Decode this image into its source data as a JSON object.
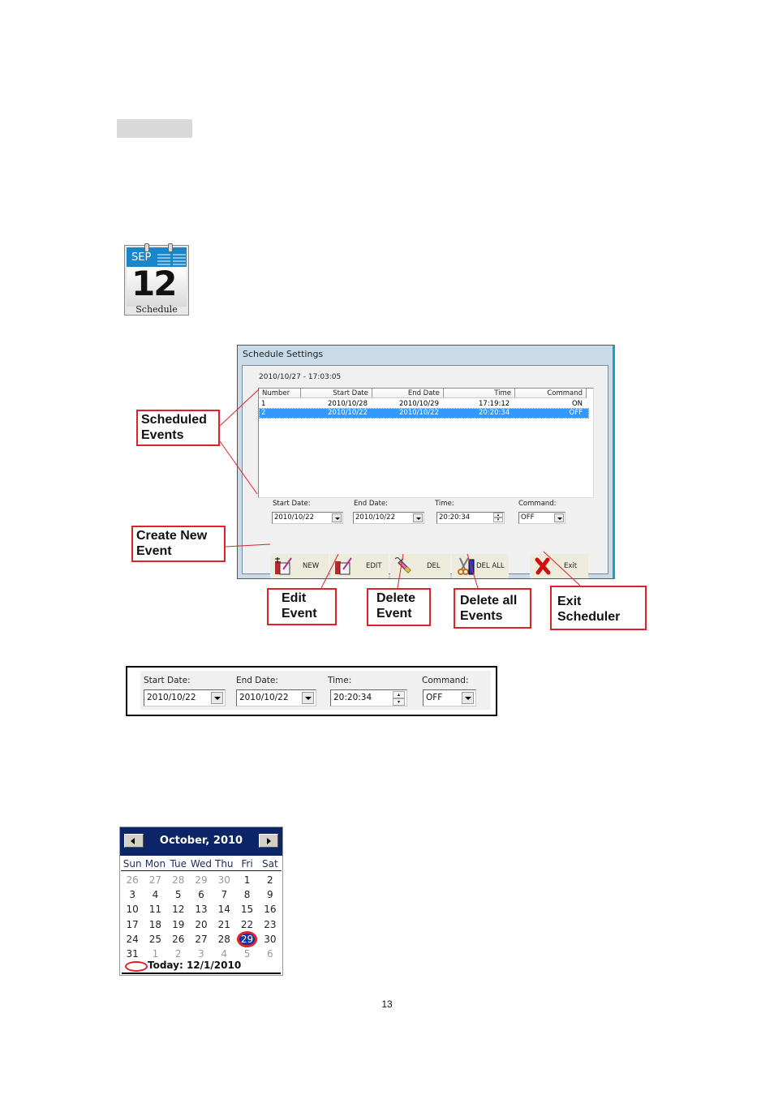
{
  "page": {
    "number": "13"
  },
  "schedule_icon": {
    "month": "SEP",
    "day": "12",
    "label": "Schedule"
  },
  "window": {
    "title": "Schedule Settings",
    "current_datetime": "2010/10/27 - 17:03:05",
    "columns": [
      "Number",
      "Start Date",
      "End Date",
      "Time",
      "Command"
    ],
    "rows": [
      {
        "number": "1",
        "start_date": "2010/10/28",
        "end_date": "2010/10/29",
        "time": "17:19:12",
        "command": "ON",
        "selected": false
      },
      {
        "number": "2",
        "start_date": "2010/10/22",
        "end_date": "2010/10/22",
        "time": "20:20:34",
        "command": "OFF",
        "selected": true
      }
    ],
    "fields": {
      "start_date_label": "Start Date:",
      "start_date_value": "2010/10/22",
      "end_date_label": "End Date:",
      "end_date_value": "2010/10/22",
      "time_label": "Time:",
      "time_value": "20:20:34",
      "command_label": "Command:",
      "command_value": "OFF"
    },
    "buttons": {
      "new": "NEW",
      "edit": "EDIT",
      "del": "DEL",
      "del_all": "DEL ALL",
      "exit": "Exit"
    }
  },
  "callouts": {
    "scheduled_events": [
      "Scheduled",
      "Events"
    ],
    "create_new_event": [
      "Create New",
      "Event"
    ],
    "edit_event": [
      "Edit",
      "Event"
    ],
    "delete_event": [
      "Delete",
      "Event"
    ],
    "delete_all_events": [
      "Delete all",
      "Events"
    ],
    "exit_scheduler": [
      "Exit",
      "Scheduler"
    ]
  },
  "colors": {
    "callout_border": "#e0202a",
    "selection": "#3399ff",
    "calendar_header": "#0b2567"
  },
  "month_calendar": {
    "title": "October, 2010",
    "weekdays": [
      "Sun",
      "Mon",
      "Tue",
      "Wed",
      "Thu",
      "Fri",
      "Sat"
    ],
    "weeks": [
      [
        {
          "d": "26",
          "o": true
        },
        {
          "d": "27",
          "o": true
        },
        {
          "d": "28",
          "o": true
        },
        {
          "d": "29",
          "o": true
        },
        {
          "d": "30",
          "o": true
        },
        {
          "d": "1"
        },
        {
          "d": "2"
        }
      ],
      [
        {
          "d": "3"
        },
        {
          "d": "4"
        },
        {
          "d": "5"
        },
        {
          "d": "6"
        },
        {
          "d": "7"
        },
        {
          "d": "8"
        },
        {
          "d": "9"
        }
      ],
      [
        {
          "d": "10"
        },
        {
          "d": "11"
        },
        {
          "d": "12"
        },
        {
          "d": "13"
        },
        {
          "d": "14"
        },
        {
          "d": "15"
        },
        {
          "d": "16"
        }
      ],
      [
        {
          "d": "17"
        },
        {
          "d": "18"
        },
        {
          "d": "19"
        },
        {
          "d": "20"
        },
        {
          "d": "21"
        },
        {
          "d": "22"
        },
        {
          "d": "23"
        }
      ],
      [
        {
          "d": "24"
        },
        {
          "d": "25"
        },
        {
          "d": "26"
        },
        {
          "d": "27"
        },
        {
          "d": "28"
        },
        {
          "d": "29",
          "hl": true
        },
        {
          "d": "30"
        }
      ],
      [
        {
          "d": "31"
        },
        {
          "d": "1",
          "o": true
        },
        {
          "d": "2",
          "o": true
        },
        {
          "d": "3",
          "o": true
        },
        {
          "d": "4",
          "o": true
        },
        {
          "d": "5",
          "o": true
        },
        {
          "d": "6",
          "o": true
        }
      ]
    ],
    "today_label": "Today: 12/1/2010"
  }
}
